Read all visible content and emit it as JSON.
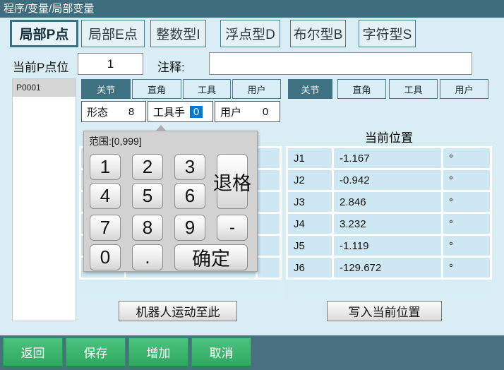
{
  "colors": {
    "accent_teal": "#3e6d7d",
    "selection_blue": "#0078d7",
    "button_green": "#34b169",
    "page_bg": "#d9eef4"
  },
  "title_bar": {
    "title": "程序/变量/局部变量"
  },
  "tabs": [
    {
      "label": "局部P点",
      "selected": true
    },
    {
      "label": "局部E点",
      "selected": false
    },
    {
      "label": "整数型I",
      "selected": false
    },
    {
      "label": "浮点型D",
      "selected": false
    },
    {
      "label": "布尔型B",
      "selected": false
    },
    {
      "label": "字符型S",
      "selected": false
    }
  ],
  "point_header": {
    "label": "当前P点位",
    "value": "1",
    "comment_label": "注释:",
    "comment_value": ""
  },
  "point_list": [
    {
      "id": "P0001",
      "selected": true
    }
  ],
  "coord_tabs": {
    "joint": "关节",
    "cartesian": "直角",
    "tool": "工具",
    "user": "用户",
    "selected": "关节"
  },
  "fields": {
    "form": {
      "label": "形态",
      "value": "8"
    },
    "tool_hand": {
      "label": "工具手",
      "value": "0",
      "editing": true
    },
    "user": {
      "label": "用户",
      "value": "0"
    }
  },
  "keypad": {
    "range_label": "范围:[0,999]",
    "keys": {
      "k1": "1",
      "k2": "2",
      "k3": "3",
      "k4": "4",
      "k5": "5",
      "k6": "6",
      "k7": "7",
      "k8": "8",
      "k9": "9",
      "k0": "0",
      "dot": ".",
      "minus": "-",
      "backspace": "退格",
      "confirm": "确定"
    }
  },
  "current_position": {
    "title": "当前位置",
    "rows": [
      {
        "label": "J1",
        "value": "-1.167",
        "unit": "°"
      },
      {
        "label": "J2",
        "value": "-0.942",
        "unit": "°"
      },
      {
        "label": "J3",
        "value": "2.846",
        "unit": "°"
      },
      {
        "label": "J4",
        "value": "3.232",
        "unit": "°"
      },
      {
        "label": "J5",
        "value": "-1.119",
        "unit": "°"
      },
      {
        "label": "J6",
        "value": "-129.672",
        "unit": "°"
      }
    ]
  },
  "actions": {
    "move_to": "机器人运动至此",
    "write_position": "写入当前位置"
  },
  "bottom_bar": [
    {
      "label": "返回"
    },
    {
      "label": "保存"
    },
    {
      "label": "增加"
    },
    {
      "label": "取消"
    }
  ]
}
